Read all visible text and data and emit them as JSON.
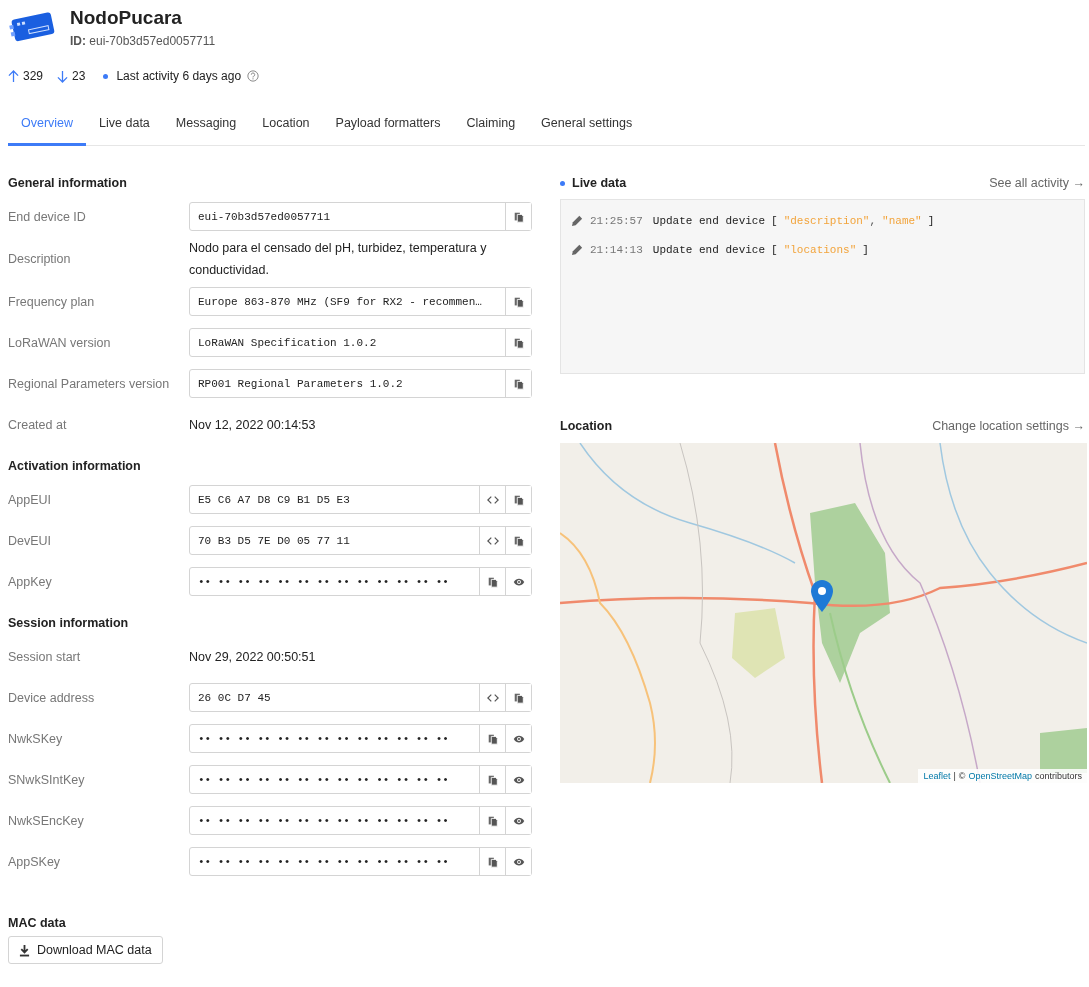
{
  "device": {
    "name": "NodoPucara",
    "id": "**ID:** eui-70b3d57ed0057711"
  },
  "stats": {
    "uplink": "329",
    "downlink": "23",
    "activity": "Last activity 6 days ago"
  },
  "tabs": [
    {
      "label": "Overview",
      "selected": true
    },
    {
      "label": "Live data",
      "selected": false
    },
    {
      "label": "Messaging",
      "selected": false
    },
    {
      "label": "Location",
      "selected": false
    },
    {
      "label": "Payload formatters",
      "selected": false
    },
    {
      "label": "Claiming",
      "selected": false
    },
    {
      "label": "General settings",
      "selected": false
    }
  ],
  "sections": [
    {
      "title": "General information",
      "rows": [
        {
          "label": "End device ID",
          "kind": "copy",
          "value": "eui-70b3d57ed0057711"
        },
        {
          "label": "Description",
          "kind": "text",
          "value": "Nodo para el censado del pH, turbidez, temperatura y conductividad."
        },
        {
          "label": "Frequency plan",
          "kind": "copy",
          "value": "Europe 863-870 MHz (SF9 for RX2 - recommen…"
        },
        {
          "label": "LoRaWAN version",
          "kind": "copy",
          "value": "LoRaWAN Specification 1.0.2"
        },
        {
          "label": "Regional Parameters version",
          "kind": "copy",
          "value": "RP001 Regional Parameters 1.0.2"
        },
        {
          "label": "Created at",
          "kind": "text",
          "value": "Nov 12, 2022 00:14:53"
        }
      ]
    },
    {
      "title": "Activation information",
      "rows": [
        {
          "label": "AppEUI",
          "kind": "hex",
          "value": "E5 C6 A7 D8 C9 B1 D5 E3"
        },
        {
          "label": "DevEUI",
          "kind": "hex",
          "value": "70 B3 D5 7E D0 05 77 11"
        },
        {
          "label": "AppKey",
          "kind": "secret",
          "value": "•• •• •• •• •• •• •• •• •• •• •• •• ••"
        }
      ]
    },
    {
      "title": "Session information",
      "rows": [
        {
          "label": "Session start",
          "kind": "text",
          "value": "Nov 29, 2022 00:50:51"
        },
        {
          "label": "Device address",
          "kind": "hex",
          "value": "26 0C D7 45"
        },
        {
          "label": "NwkSKey",
          "kind": "secret",
          "value": "•• •• •• •• •• •• •• •• •• •• •• •• ••"
        },
        {
          "label": "SNwkSIntKey",
          "kind": "secret",
          "value": "•• •• •• •• •• •• •• •• •• •• •• •• ••"
        },
        {
          "label": "NwkSEncKey",
          "kind": "secret",
          "value": "•• •• •• •• •• •• •• •• •• •• •• •• ••"
        },
        {
          "label": "AppSKey",
          "kind": "secret",
          "value": "•• •• •• •• •• •• •• •• •• •• •• •• ••"
        }
      ]
    }
  ],
  "mac": {
    "title": "MAC data",
    "button": "Download MAC data"
  },
  "live_data": {
    "title": "Live data",
    "link": "See all activity →",
    "events": [
      {
        "time": "21:25:57",
        "text": "Update end device",
        "open": "[",
        "args": [
          "\"description\"",
          "\"name\""
        ],
        "separator": ",",
        "close": "]"
      },
      {
        "time": "21:14:13",
        "text": "Update end device",
        "open": "[",
        "args": [
          "\"locations\""
        ],
        "close": "]"
      }
    ]
  },
  "location": {
    "title": "Location",
    "link": "Change location settings →",
    "map": {
      "kind": "picture",
      "attribution": {
        "leaflet": "Leaflet",
        "divider": "|",
        "copyright": "©",
        "osm": "OpenStreetMap",
        "suffix": "contributors"
      }
    }
  }
}
